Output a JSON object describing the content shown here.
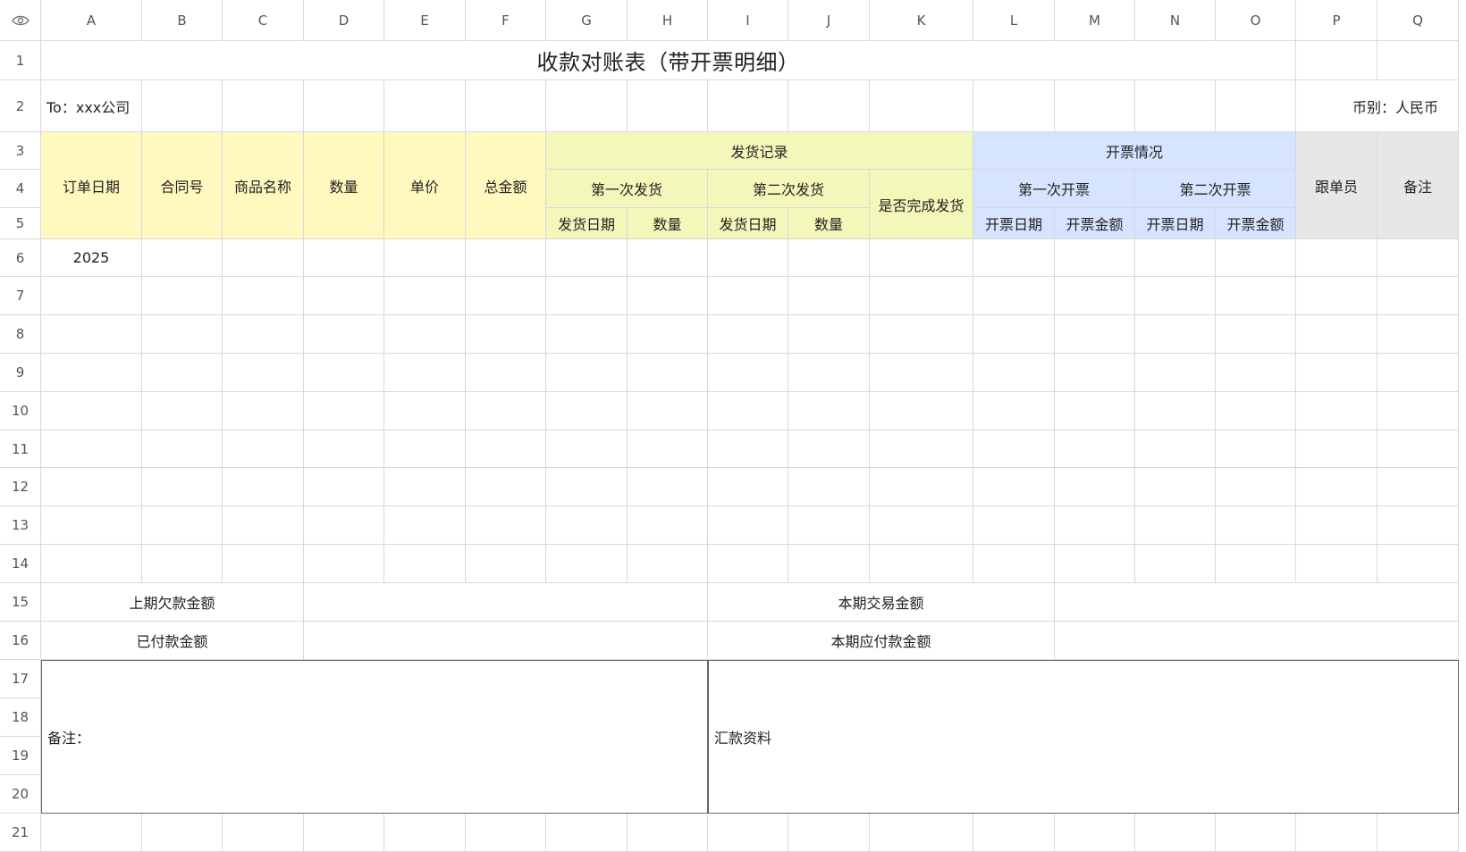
{
  "columns": [
    "A",
    "B",
    "C",
    "D",
    "E",
    "F",
    "G",
    "H",
    "I",
    "J",
    "K",
    "L",
    "M",
    "N",
    "O",
    "P",
    "Q"
  ],
  "rows": [
    "1",
    "2",
    "3",
    "4",
    "5",
    "6",
    "7",
    "8",
    "9",
    "10",
    "11",
    "12",
    "13",
    "14",
    "15",
    "16",
    "17",
    "18",
    "19",
    "20",
    "21"
  ],
  "corner_icon": "eye-icon",
  "title": "收款对账表（带开票明细）",
  "to_label": "To：xxx公司",
  "currency_label": "币别：人民币",
  "headers": {
    "order_date": "订单日期",
    "contract_no": "合同号",
    "product_name": "商品名称",
    "quantity": "数量",
    "unit_price": "单价",
    "total_amount": "总金额",
    "shipment_records": "发货记录",
    "first_shipment": "第一次发货",
    "second_shipment": "第二次发货",
    "ship_date_1": "发货日期",
    "ship_qty_1": "数量",
    "ship_date_2": "发货日期",
    "ship_qty_2": "数量",
    "shipment_complete": "是否完成发货",
    "invoice_status": "开票情况",
    "first_invoice": "第一次开票",
    "second_invoice": "第二次开票",
    "invoice_date_1": "开票日期",
    "invoice_amount_1": "开票金额",
    "invoice_date_2": "开票日期",
    "invoice_amount_2": "开票金额",
    "follower": "跟单员",
    "remarks": "备注"
  },
  "data_rows": [
    [
      "2025",
      "",
      "",
      "",
      "",
      "",
      "",
      "",
      "",
      "",
      "",
      "",
      "",
      "",
      "",
      "",
      ""
    ]
  ],
  "summary": {
    "prev_arrears": "上期欠款金额",
    "paid_amount": "已付款金额",
    "current_trade": "本期交易金额",
    "current_payable": "本期应付款金额",
    "notes_label": "备注：",
    "remit_info": "汇款资料"
  },
  "colors": {
    "yellow": "#fff8bf",
    "green": "#f1f8b9",
    "blue": "#d6e4ff",
    "gray": "#e7e7e7",
    "gridline": "#d9d9d9"
  }
}
